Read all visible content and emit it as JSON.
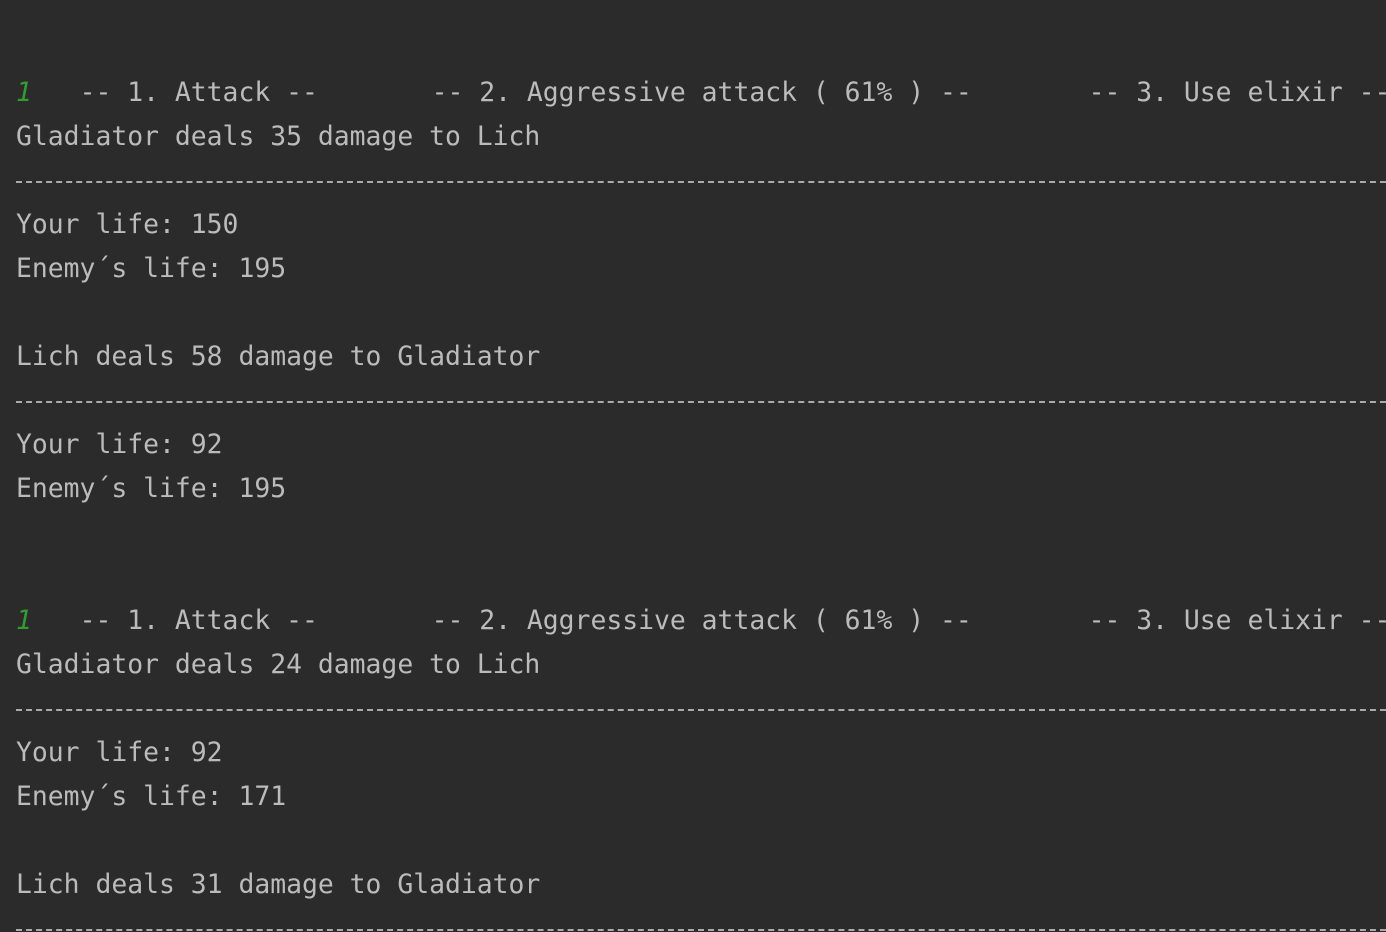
{
  "colors": {
    "background": "#2b2b2b",
    "text": "#bbbbbb",
    "user_input": "#2f9d2f"
  },
  "turns": [
    {
      "menu": {
        "option1": "-- 1. Attack --",
        "option2": "-- 2. Aggressive attack ( 61% ) --",
        "option3": "-- 3. Use elixir --"
      },
      "input": "1",
      "player_action": "Gladiator deals 35 damage to Lich",
      "after_player": {
        "your_life": "Your life: 150",
        "enemy_life": "Enemy´s life: 195"
      },
      "enemy_action": "Lich deals 58 damage to Gladiator",
      "after_enemy": {
        "your_life": "Your life: 92",
        "enemy_life": "Enemy´s life: 195"
      }
    },
    {
      "menu": {
        "option1": "-- 1. Attack --",
        "option2": "-- 2. Aggressive attack ( 61% ) --",
        "option3": "-- 3. Use elixir --"
      },
      "input": "1",
      "player_action": "Gladiator deals 24 damage to Lich",
      "after_player": {
        "your_life": "Your life: 92",
        "enemy_life": "Enemy´s life: 171"
      },
      "enemy_action": "Lich deals 31 damage to Gladiator"
    }
  ]
}
